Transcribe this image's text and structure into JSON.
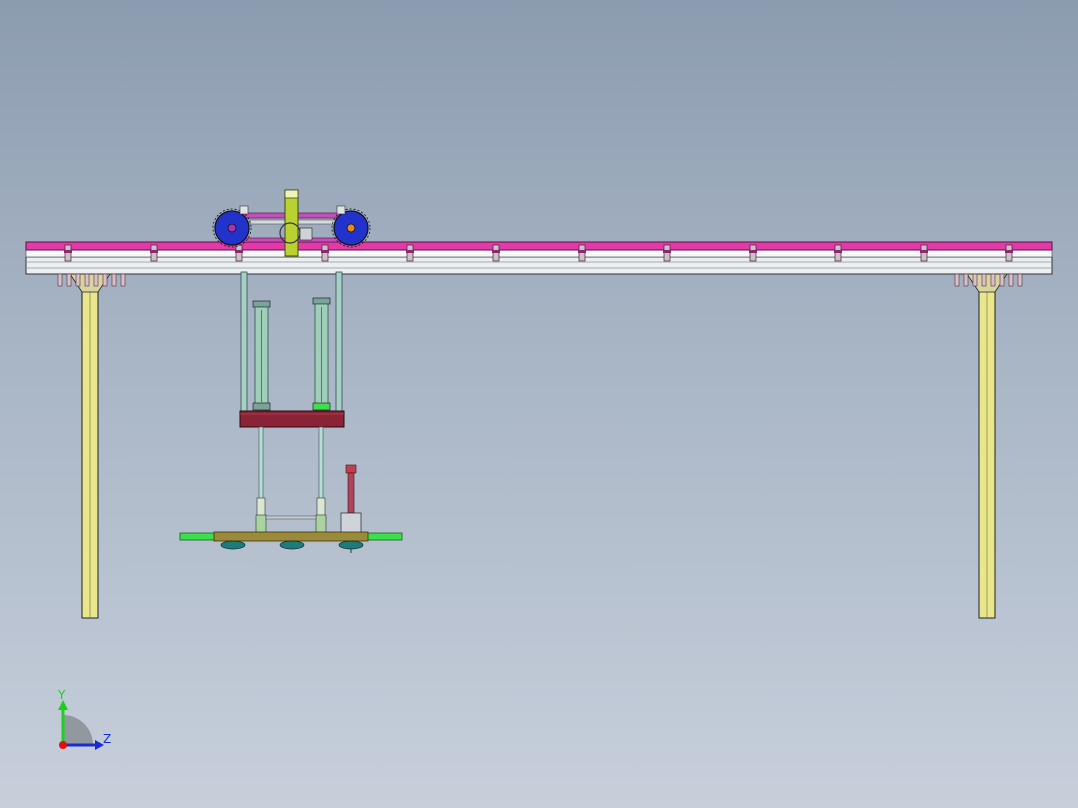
{
  "triad": {
    "y_label": "Y",
    "z_label": "Z",
    "y_color": "#1fcf1f",
    "z_color": "#1a2bd6",
    "origin_color": "#e01010"
  },
  "colors": {
    "top_rail": "#e23aa8",
    "beam": "#eceff2",
    "post": "#e9e68c",
    "carriage_wheel": "#2233cc",
    "wheel_hub_left": "#b02fb0",
    "wheel_hub_right": "#e58a1a",
    "drive_column": "#b9d231",
    "lift_plate": "#8a2335",
    "gripper_bar": "#9a8a3a",
    "gripper_ends": "#3be04a",
    "suction_cup": "#1f7a7a",
    "cylinder": "#9fcfb9",
    "guide_rod": "#b6ded7"
  }
}
